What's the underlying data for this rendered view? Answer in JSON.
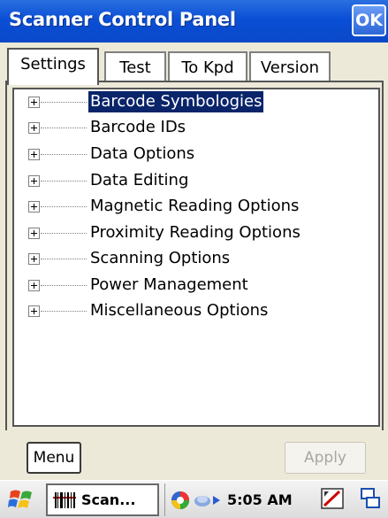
{
  "window": {
    "title": "Scanner Control Panel",
    "ok_label": "OK"
  },
  "tabs": [
    {
      "label": "Settings",
      "active": true
    },
    {
      "label": "Test",
      "active": false
    },
    {
      "label": "To Kpd",
      "active": false
    },
    {
      "label": "Version",
      "active": false
    }
  ],
  "tree": {
    "items": [
      {
        "label": "Barcode Symbologies",
        "selected": true,
        "expand_icon": "plus-box-icon"
      },
      {
        "label": "Barcode IDs",
        "selected": false,
        "expand_icon": "plus-box-icon"
      },
      {
        "label": "Data Options",
        "selected": false,
        "expand_icon": "plus-box-icon"
      },
      {
        "label": "Data Editing",
        "selected": false,
        "expand_icon": "plus-box-icon"
      },
      {
        "label": "Magnetic Reading Options",
        "selected": false,
        "expand_icon": "plus-box-icon"
      },
      {
        "label": "Proximity Reading Options",
        "selected": false,
        "expand_icon": "plus-box-icon"
      },
      {
        "label": "Scanning Options",
        "selected": false,
        "expand_icon": "plus-box-icon"
      },
      {
        "label": "Power Management",
        "selected": false,
        "expand_icon": "plus-box-icon"
      },
      {
        "label": "Miscellaneous Options",
        "selected": false,
        "expand_icon": "plus-box-icon"
      }
    ]
  },
  "buttons": {
    "menu_label": "Menu",
    "apply_label": "Apply",
    "apply_enabled": false
  },
  "taskbar": {
    "start_icon": "windows-flag-icon",
    "task_label": "Scan...",
    "task_icon": "barcode-icon",
    "tray_icons": [
      "color-disc-icon",
      "network-arrow-icon",
      "sync-icon",
      "screen-icon"
    ],
    "clock": "5:05 AM"
  },
  "colors": {
    "titlebar": "#0a4fd6",
    "selection": "#0a246a",
    "background": "#ece9d8",
    "apply_disabled_text": "#a8a79f"
  }
}
